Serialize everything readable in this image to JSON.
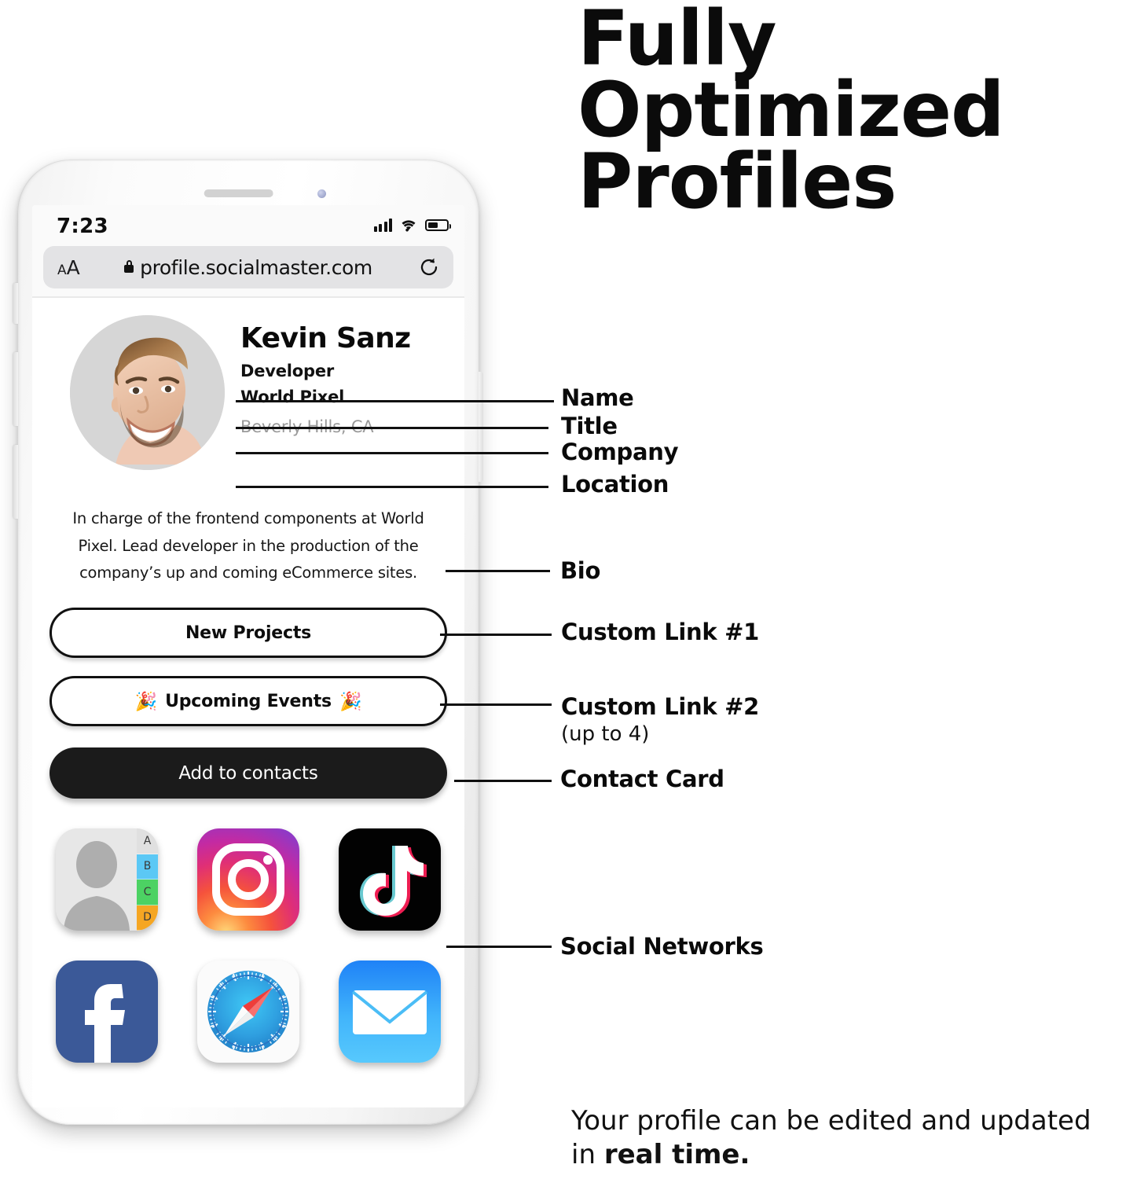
{
  "headline": {
    "lines": [
      "Fully",
      "Optimized",
      "Profiles"
    ]
  },
  "footer": {
    "text_before": "Your profile can be edited and updated in ",
    "emphasis": "real time.",
    "line1": "Your profile can be edited and updated",
    "line2_prefix": "in ",
    "line2_bold": "real time."
  },
  "phone": {
    "status": {
      "time": "7:23",
      "signal_icon": "cellular-bars-icon",
      "wifi_icon": "wifi-icon",
      "battery_icon": "battery-icon"
    },
    "browser": {
      "text_size_small": "A",
      "text_size_large": "A",
      "lock_icon": "lock-icon",
      "url": "profile.socialmaster.com",
      "reload_icon": "reload-icon"
    },
    "profile": {
      "avatar_alt": "profile-photo",
      "name": "Kevin Sanz",
      "title": "Developer",
      "company": "World Pixel",
      "location": "Beverly Hills, CA",
      "bio": "In charge of the frontend components at World Pixel. Lead developer in the production of the company’s up and coming eCommerce sites.",
      "links": [
        {
          "label": "New Projects",
          "emoji_left": "",
          "emoji_right": ""
        },
        {
          "label": "Upcoming Events",
          "emoji_left": "🎉",
          "emoji_right": "🎉"
        }
      ],
      "contact_button": "Add to contacts",
      "social_icons": [
        {
          "name": "contacts-icon",
          "tabs": [
            "A",
            "B",
            "C",
            "D"
          ]
        },
        {
          "name": "instagram-icon"
        },
        {
          "name": "tiktok-icon"
        },
        {
          "name": "facebook-icon"
        },
        {
          "name": "safari-icon"
        },
        {
          "name": "mail-icon"
        }
      ]
    }
  },
  "annotations": [
    {
      "label": "Name"
    },
    {
      "label": "Title"
    },
    {
      "label": "Company"
    },
    {
      "label": "Location"
    },
    {
      "label": "Bio"
    },
    {
      "label": "Custom Link #1"
    },
    {
      "label": "Custom Link #2",
      "sub": "(up to 4)"
    },
    {
      "label": "Contact Card"
    },
    {
      "label": "Social Networks"
    }
  ],
  "colors": {
    "ink": "#0a0a0a",
    "contact_button_bg": "#1b1b1b",
    "muted_text": "#9a9a9a",
    "facebook_blue": "#3b5998",
    "mail_blue": "#1f82f7",
    "contacts_tab_b": "#5bc8f5",
    "contacts_tab_c": "#4cd263",
    "contacts_tab_d": "#f5a623"
  }
}
